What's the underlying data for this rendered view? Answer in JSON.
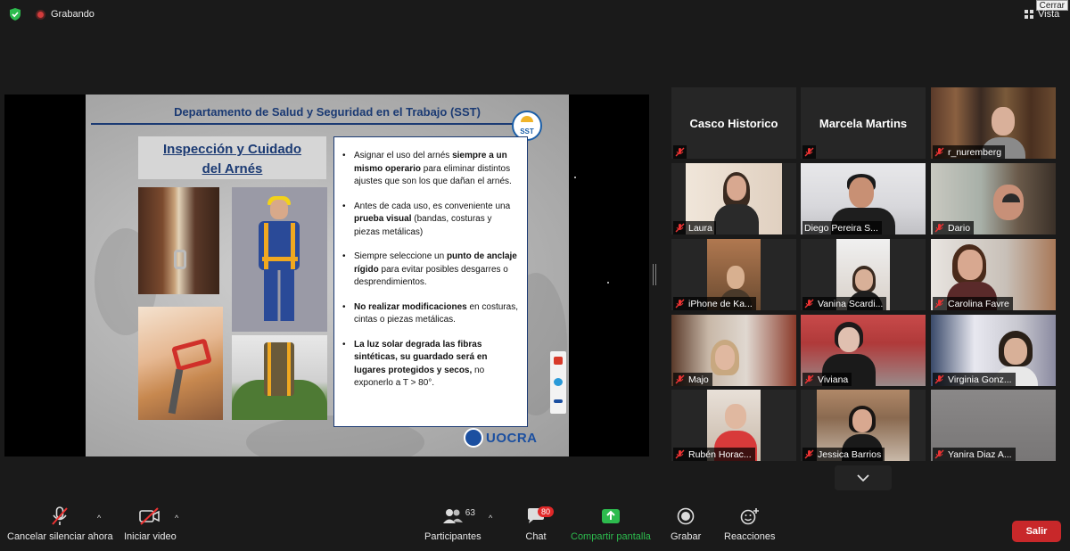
{
  "topbar": {
    "recording_label": "Grabando",
    "close_tooltip": "Cerrar",
    "view_label": "Vista"
  },
  "slide": {
    "header": "Departamento de Salud y Seguridad en el Trabajo (SST)",
    "logo_text": "SST",
    "subtitle_line1": "Inspección y Cuidado",
    "subtitle_line2": "del Arnés",
    "bullets": [
      {
        "pre": "Asignar el uso del arnés ",
        "bold": "siempre a un mismo operario",
        "post": " para eliminar distintos ajustes que son los que dañan el arnés."
      },
      {
        "pre": "Antes de cada uso, es conveniente una ",
        "bold": "prueba visual",
        "post": " (bandas, costuras y piezas metálicas)"
      },
      {
        "pre": "Siempre seleccione un ",
        "bold": "punto de anclaje rígido",
        "post": " para evitar posibles desgarres o desprendimientos."
      },
      {
        "pre": "",
        "bold": "No realizar modificaciones",
        "post": " en costuras, cintas o piezas metálicas."
      },
      {
        "pre": "",
        "bold": "La luz solar degrada las fibras sintéticas, su guardado será en lugares protegidos y secos,",
        "post": " no exponerlo a T > 80°."
      }
    ],
    "brand": "UOCRA"
  },
  "gallery": {
    "tiles": [
      {
        "name": "Casco Historico",
        "type": "name-only"
      },
      {
        "name": "Marcela Martins",
        "type": "name-only"
      },
      {
        "name": "r_nuremberg",
        "type": "video"
      },
      {
        "name": "Laura",
        "type": "video"
      },
      {
        "name": "Diego Pereira S...",
        "type": "video",
        "active": true
      },
      {
        "name": "Dario",
        "type": "video"
      },
      {
        "name": "iPhone de Ka...",
        "type": "video"
      },
      {
        "name": "Vanina Scardi...",
        "type": "video"
      },
      {
        "name": "Carolina Favre",
        "type": "video"
      },
      {
        "name": "Majo",
        "type": "video"
      },
      {
        "name": "Viviana",
        "type": "video"
      },
      {
        "name": "Virginia Gonz...",
        "type": "video"
      },
      {
        "name": "Rubén Horac...",
        "type": "video"
      },
      {
        "name": "Jessica Barrios",
        "type": "video"
      },
      {
        "name": "Yanira Diaz A...",
        "type": "video"
      }
    ]
  },
  "toolbar": {
    "unmute_label": "Cancelar silenciar ahora",
    "video_label": "Iniciar video",
    "participants_label": "Participantes",
    "participants_count": "63",
    "chat_label": "Chat",
    "chat_badge": "80",
    "share_label": "Compartir pantalla",
    "record_label": "Grabar",
    "reactions_label": "Reacciones",
    "leave_label": "Salir"
  },
  "colors": {
    "share_green": "#2dbb4e",
    "leave_red": "#c8282a",
    "active_speaker": "#c8e04a",
    "slide_blue": "#1b3a73"
  }
}
